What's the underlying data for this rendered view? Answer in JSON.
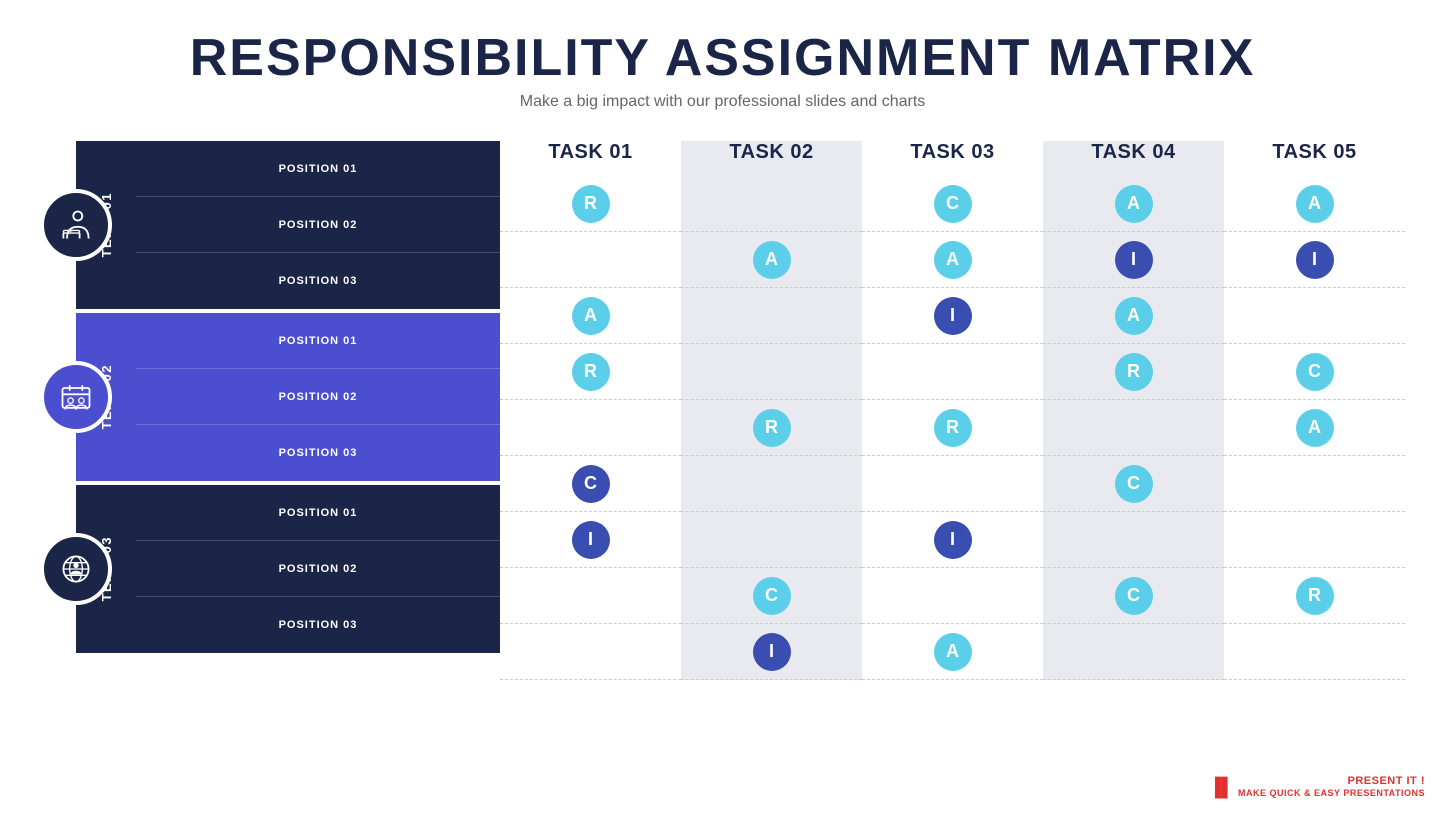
{
  "header": {
    "title": "RESPONSIBILITY ASSIGNMENT MATRIX",
    "subtitle": "Make a big impact with our professional slides and charts"
  },
  "tasks": [
    {
      "label": "TASK 01",
      "shaded": false
    },
    {
      "label": "TASK 02",
      "shaded": true
    },
    {
      "label": "TASK 03",
      "shaded": false
    },
    {
      "label": "TASK 04",
      "shaded": true
    },
    {
      "label": "TASK 05",
      "shaded": false
    }
  ],
  "teams": [
    {
      "name": "TEAM 01",
      "colorClass": "team1-color",
      "iconBgClass": "team1-icon-bg",
      "positions": [
        "POSITION 01",
        "POSITION 02",
        "POSITION 03"
      ]
    },
    {
      "name": "TEAM 02",
      "colorClass": "team2-color",
      "iconBgClass": "team2-icon-bg",
      "positions": [
        "POSITION 01",
        "POSITION 02",
        "POSITION 03"
      ]
    },
    {
      "name": "TEAM 03",
      "colorClass": "team3-color",
      "iconBgClass": "team3-icon-bg",
      "positions": [
        "POSITION 01",
        "POSITION 02",
        "POSITION 03"
      ]
    }
  ],
  "grid": [
    [
      "R-light",
      "",
      "C-light",
      "A-light",
      "A-light"
    ],
    [
      "",
      "A-light",
      "A-light",
      "I-dark",
      "I-dark"
    ],
    [
      "A-light",
      "",
      "I-dark",
      "A-light",
      ""
    ],
    [
      "R-light",
      "",
      "",
      "R-light",
      "C-light"
    ],
    [
      "",
      "R-light",
      "R-light",
      "",
      "A-light"
    ],
    [
      "C-dark",
      "",
      "",
      "C-light",
      ""
    ],
    [
      "I-dark",
      "",
      "I-dark",
      "",
      ""
    ],
    [
      "",
      "C-light",
      "",
      "C-light",
      "R-light"
    ],
    [
      "",
      "I-dark",
      "A-light",
      "",
      ""
    ]
  ],
  "watermark": {
    "line1": "Present it !",
    "line2": "MAKE QUICK & EASY PRESENTATIONS"
  }
}
